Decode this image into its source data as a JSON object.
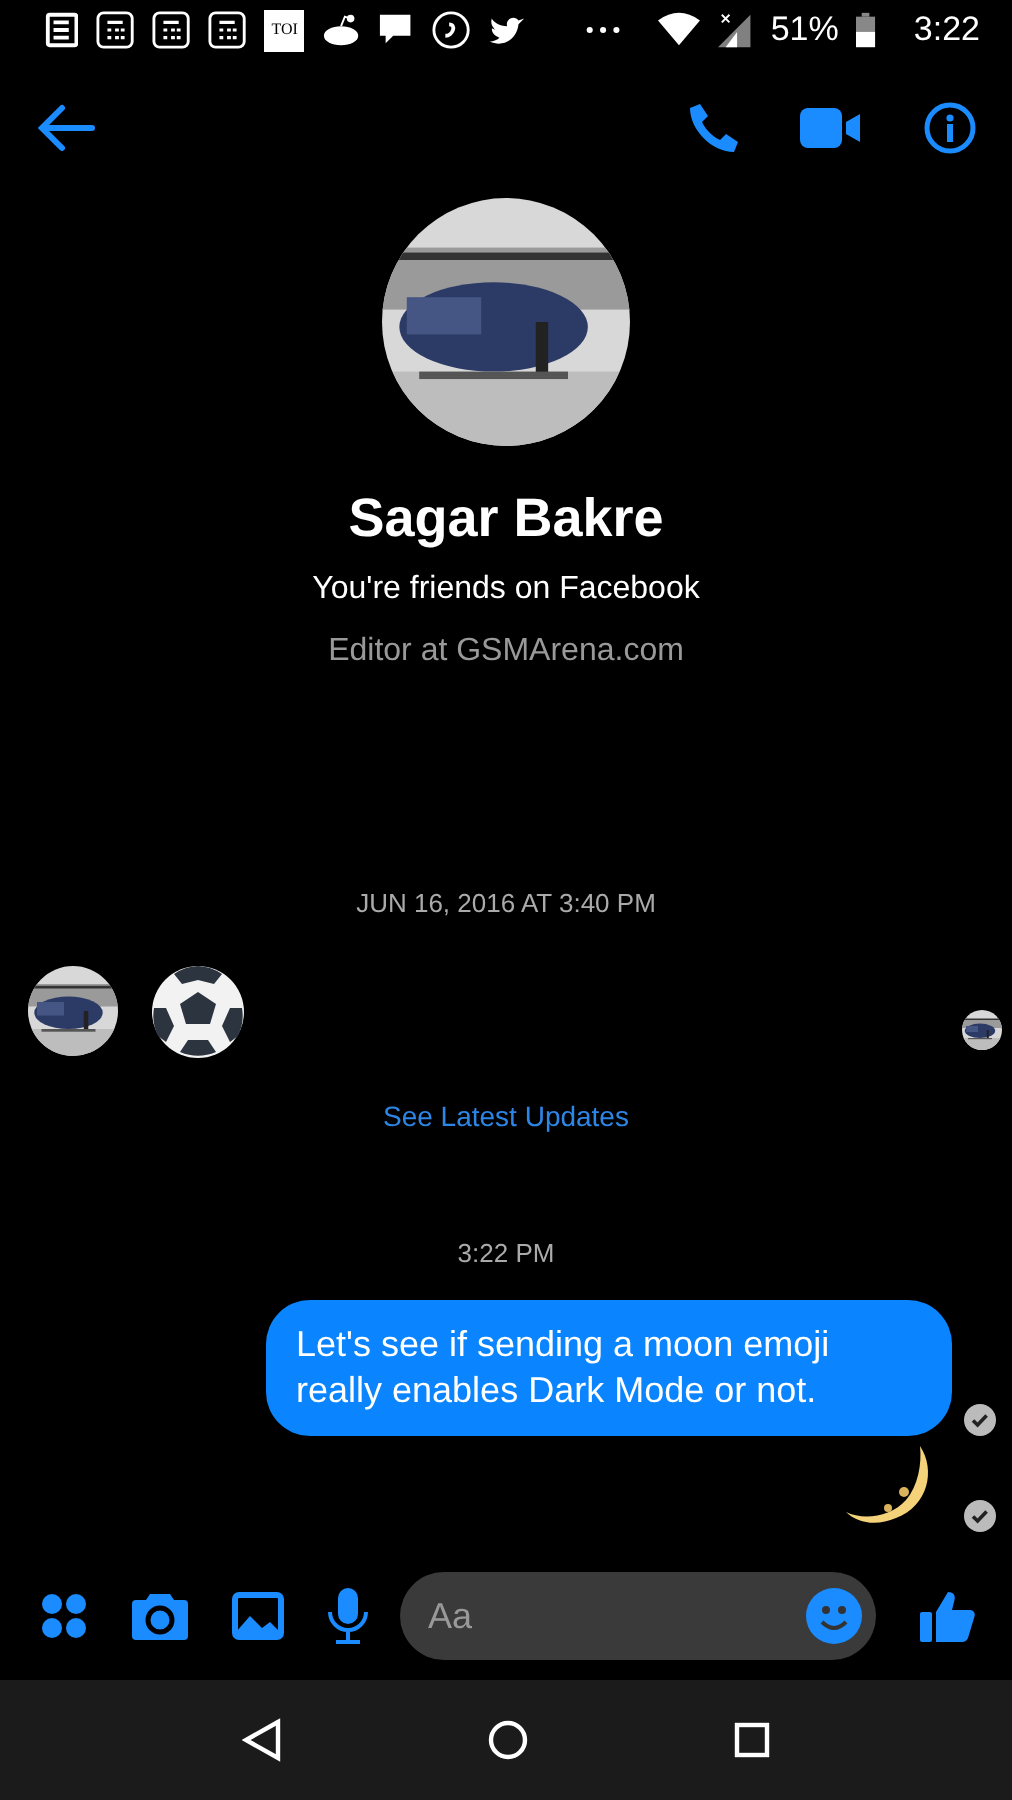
{
  "status_bar": {
    "toi_label": "TOI",
    "battery": "51%",
    "time": "3:22"
  },
  "profile": {
    "name": "Sagar Bakre",
    "relation": "You're friends on Facebook",
    "work": "Editor at GSMArena.com"
  },
  "messages": [
    {
      "kind": "timestamp",
      "text": "JUN 16, 2016 AT 3:40 PM"
    },
    {
      "kind": "sticker"
    },
    {
      "kind": "link",
      "text": "See Latest Updates"
    },
    {
      "kind": "timestamp",
      "text": "3:22 PM"
    },
    {
      "kind": "bubble",
      "text": "Let's see if sending a moon emoji really enables Dark Mode or not."
    },
    {
      "kind": "moon"
    }
  ],
  "composer": {
    "placeholder": "Aa"
  }
}
